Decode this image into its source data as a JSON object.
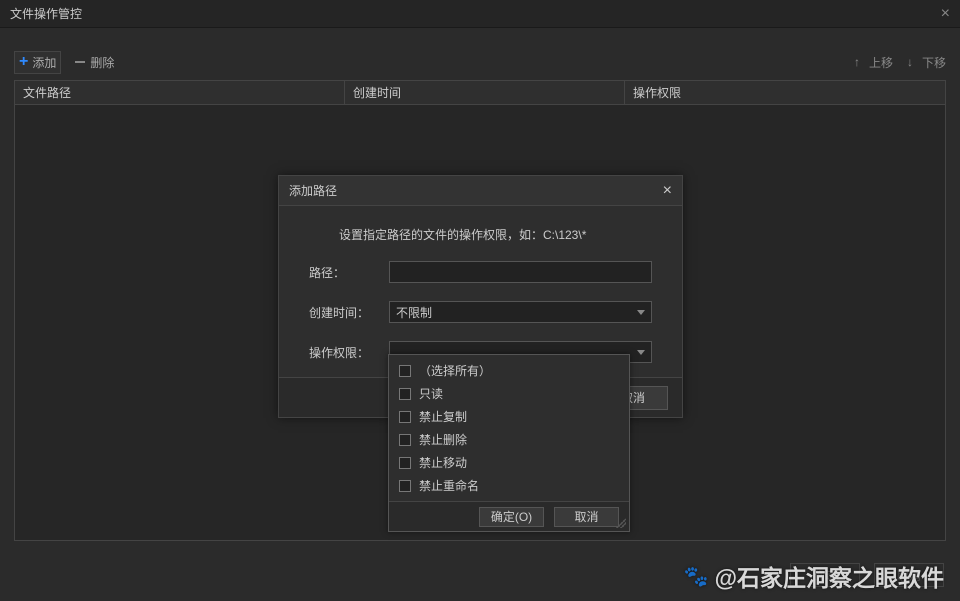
{
  "window": {
    "title": "文件操作管控"
  },
  "toolbar": {
    "add": "添加",
    "remove": "删除",
    "move_up": "上移",
    "move_down": "下移"
  },
  "table": {
    "headers": {
      "path": "文件路径",
      "create_time": "创建时间",
      "permission": "操作权限"
    }
  },
  "dialog": {
    "title": "添加路径",
    "hint": "设置指定路径的文件的操作权限，如：C:\\123\\*",
    "labels": {
      "path": "路径：",
      "create_time": "创建时间：",
      "permission": "操作权限："
    },
    "create_time_value": "不限制",
    "confirm": "确定(O)",
    "cancel": "取消"
  },
  "dropdown": {
    "options": [
      "（选择所有）",
      "只读",
      "禁止复制",
      "禁止删除",
      "禁止移动",
      "禁止重命名"
    ],
    "confirm": "确定(O)",
    "cancel": "取消"
  },
  "footer": {
    "confirm": "确定",
    "cancel": "取消"
  },
  "watermark": "@石家庄洞察之眼软件"
}
